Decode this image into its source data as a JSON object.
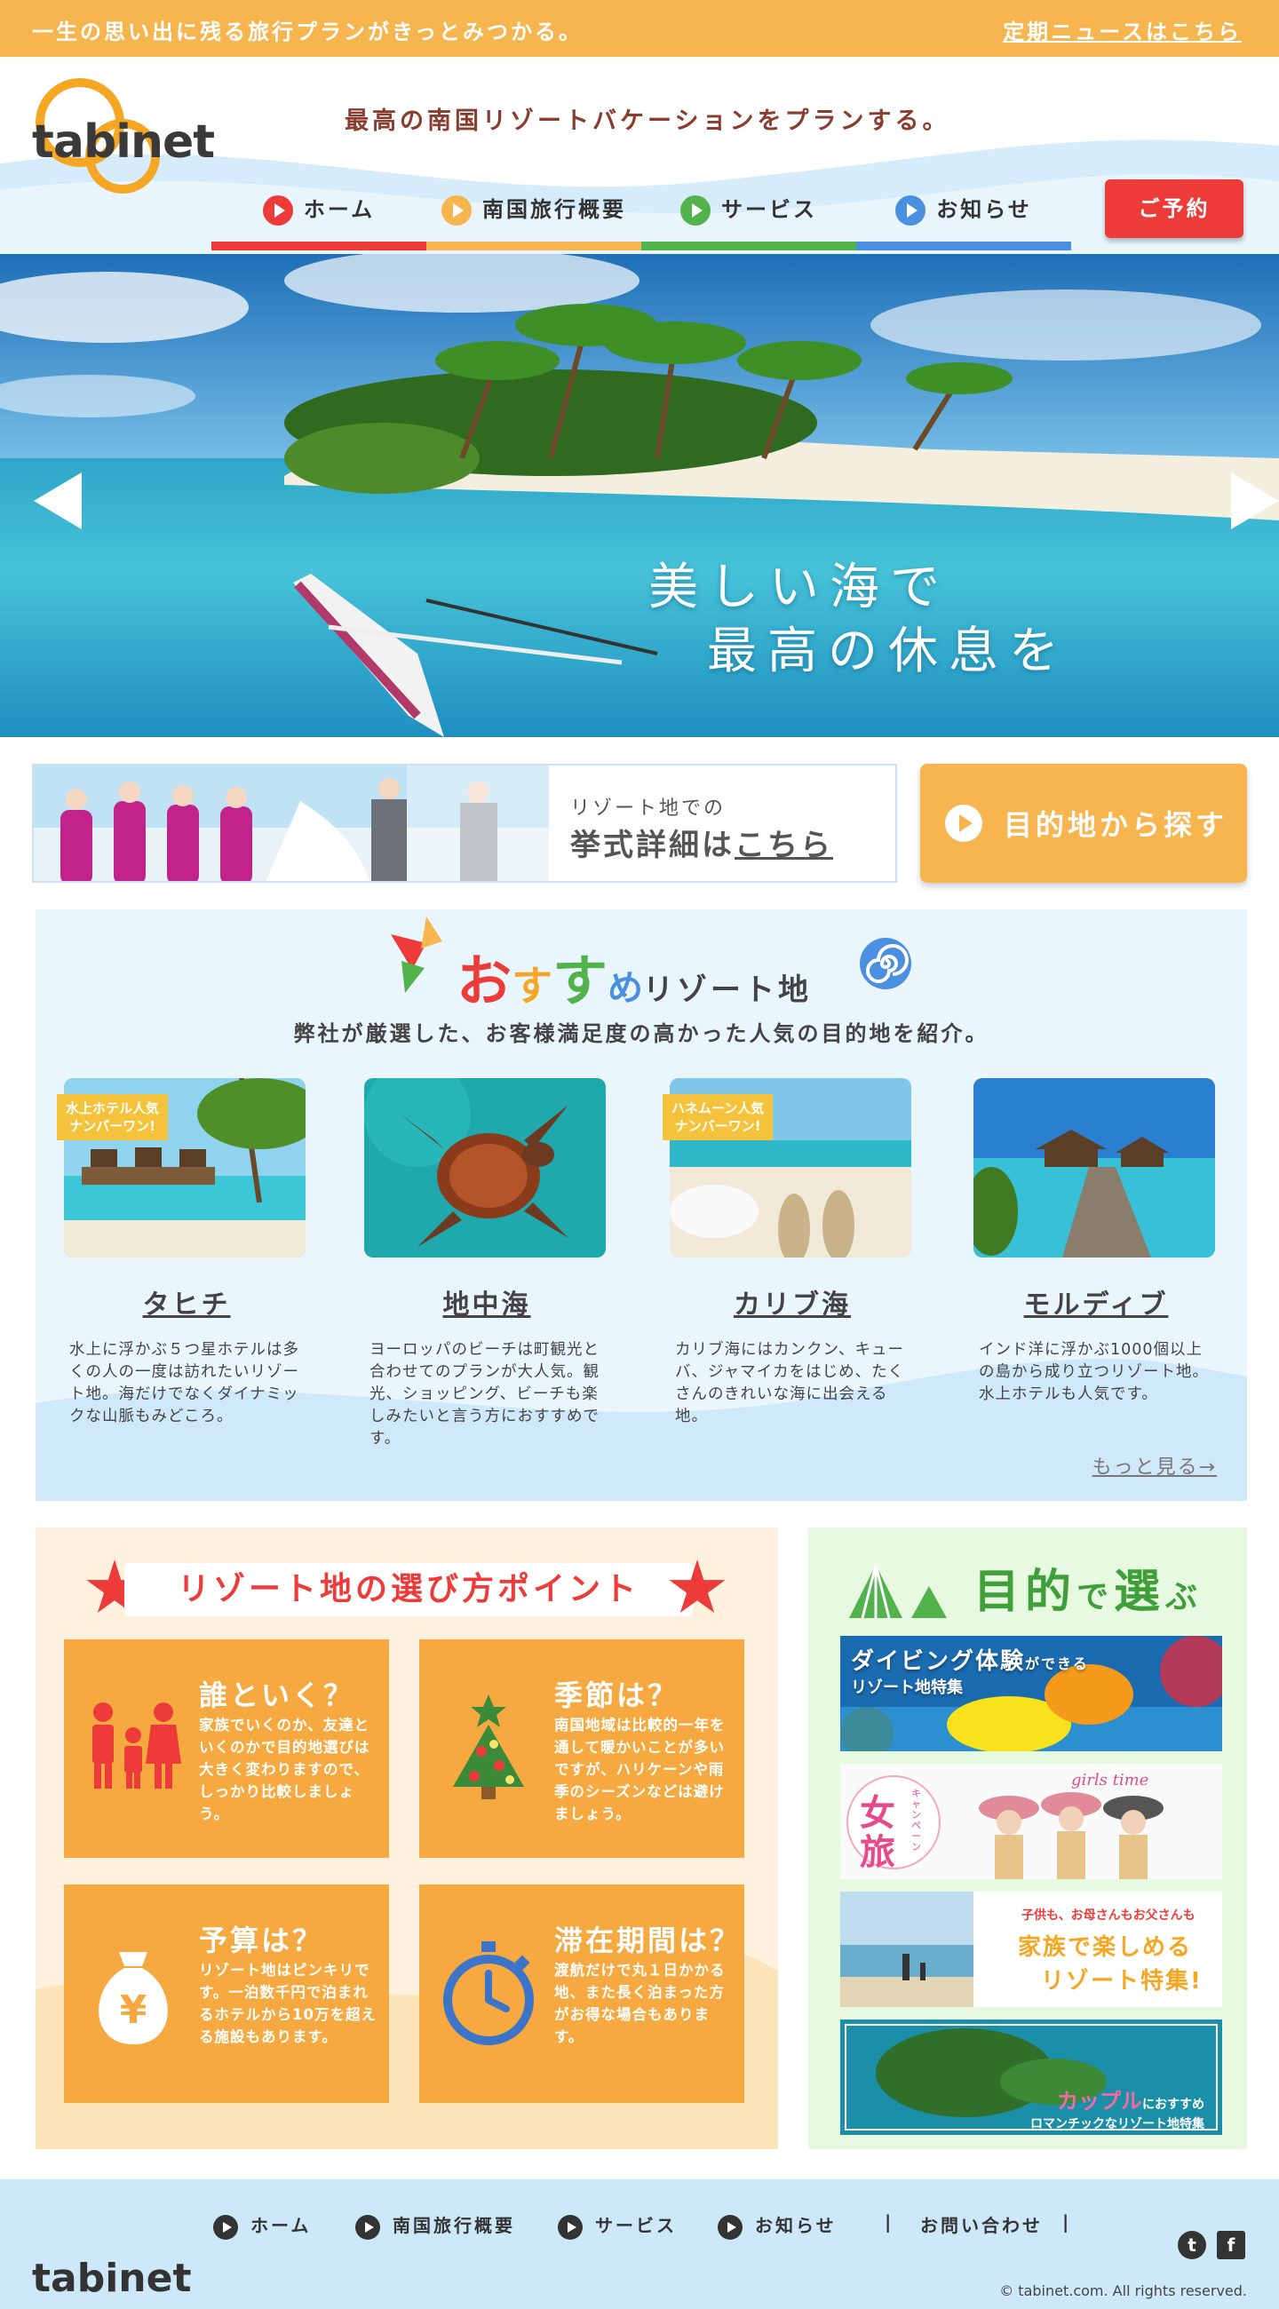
{
  "topbar": {
    "left_text": "一生の思い出に残る旅行プランがきっとみつかる。",
    "right_link": "定期ニュースはこちら"
  },
  "header": {
    "logo": "tabinet",
    "tagline": "最高の南国リゾートバケーションをプランする。",
    "nav": [
      {
        "label": "ホーム",
        "color": "#ec3b39"
      },
      {
        "label": "南国旅行概要",
        "color": "#f7b54f"
      },
      {
        "label": "サービス",
        "color": "#52b34c"
      },
      {
        "label": "お知らせ",
        "color": "#4a8fe0"
      }
    ],
    "reserve_label": "ご予約"
  },
  "hero": {
    "caption_line1": "美しい海で",
    "caption_line2": "最高の休息を"
  },
  "wedding": {
    "line1": "リゾート地での",
    "line2_prefix": "挙式詳細は",
    "line2_link": "こちら"
  },
  "destination_button": "目的地から探す",
  "recommended": {
    "title": {
      "o": "お",
      "su": "す",
      "s2": "す",
      "me": "め",
      "rest": "リゾート地"
    },
    "subtitle": "弊社が厳選した、お客様満足度の高かった人気の目的地を紹介。",
    "cards": [
      {
        "badge": "水上ホテル人気\nナンバーワン!",
        "name": "タヒチ",
        "desc": "水上に浮かぶ５つ星ホテルは多くの人の一度は訪れたいリゾート地。海だけでなくダイナミックな山脈もみどころ。"
      },
      {
        "badge": "",
        "name": "地中海",
        "desc": "ヨーロッパのビーチは町観光と合わせてのプランが大人気。観光、ショッピング、ビーチも楽しみたいと言う方におすすめです。"
      },
      {
        "badge": "ハネムーン人気\nナンバーワン!",
        "name": "カリブ海",
        "desc": "カリブ海にはカンクン、キューバ、ジャマイカをはじめ、たくさんのきれいな海に出会える地。"
      },
      {
        "badge": "",
        "name": "モルディブ",
        "desc": "インド洋に浮かぶ1000個以上の島から成り立つリゾート地。水上ホテルも人気です。"
      }
    ],
    "more_link": "もっと見る→"
  },
  "points": {
    "title": "リゾート地の選び方ポイント",
    "items": [
      {
        "heading": "誰といく？",
        "text": "家族でいくのか、友達といくのかで目的地選びは大きく変わりますので、しっかり比較しましょう。",
        "icon": "family-icon"
      },
      {
        "heading": "季節は？",
        "text": "南国地域は比較的一年を通して暖かいことが多いですが、ハリケーンや雨季のシーズンなどは避けましょう。",
        "icon": "tree-icon"
      },
      {
        "heading": "予算は？",
        "text": "リゾート地はピンキリです。一泊数千円で泊まれるホテルから10万を超える施設もあります。",
        "icon": "money-bag-icon"
      },
      {
        "heading": "滞在期間は？",
        "text": "渡航だけで丸１日かかる地、また長く泊まった方がお得な場合もあります。",
        "icon": "stopwatch-icon"
      }
    ]
  },
  "purpose": {
    "title_main1": "目的",
    "title_small1": "で",
    "title_main2": "選",
    "title_small2": "ぶ",
    "banners": [
      {
        "big": "ダイビング体験",
        "small": "ができる",
        "sub": "リゾート地特集"
      },
      {
        "circle": "女旅",
        "circle_small": "キャンペーン",
        "script": "girls time"
      },
      {
        "small": "子供も、お母さんもお父さんも",
        "big1": "家族で楽しめる",
        "big2": "リゾート特集!"
      },
      {
        "big": "カップル",
        "small": "におすすめ",
        "sub": "ロマンチックなリゾート地特集"
      }
    ]
  },
  "footer": {
    "nav": [
      "ホーム",
      "南国旅行概要",
      "サービス",
      "お知らせ"
    ],
    "contact": "お問い合わせ",
    "logo": "tabinet",
    "copyright": "© tabinet.com. All rights reserved.",
    "social": [
      "twitter-icon",
      "facebook-icon"
    ]
  }
}
